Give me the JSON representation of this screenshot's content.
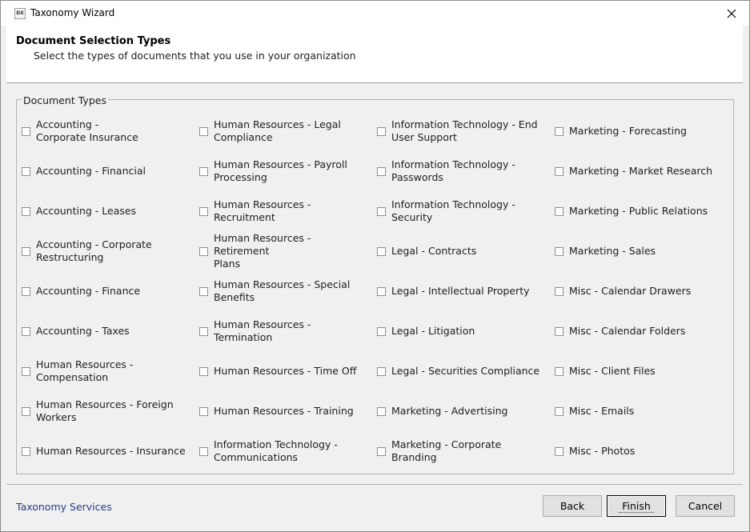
{
  "window": {
    "title": "Taxonomy Wizard",
    "icon_text": "DX"
  },
  "header": {
    "title": "Document Selection Types",
    "subtitle": "Select the types of documents that you use in your organization"
  },
  "group": {
    "label": "Document Types",
    "columns": [
      [
        "Accounting  - \nCorporate Insurance",
        "Accounting  - Financial",
        "Accounting  - Leases",
        "Accounting - Corporate\nRestructuring",
        "Accounting - Finance",
        "Accounting - Taxes",
        "Human Resources -\nCompensation",
        "Human Resources - Foreign\nWorkers",
        "Human Resources - Insurance"
      ],
      [
        "Human Resources - Legal\nCompliance",
        "Human Resources - Payroll\nProcessing",
        "Human Resources - Recruitment",
        "Human Resources - Retirement\nPlans",
        "Human Resources - Special\nBenefits",
        "Human Resources - Termination",
        "Human Resources - Time Off",
        "Human Resources - Training",
        "Information Technology -\nCommunications"
      ],
      [
        "Information Technology - End\nUser Support",
        "Information Technology -\nPasswords",
        "Information Technology -\nSecurity",
        "Legal - Contracts",
        "Legal - Intellectual Property",
        "Legal - Litigation",
        "Legal - Securities Compliance",
        "Marketing - Advertising",
        "Marketing - Corporate Branding"
      ],
      [
        "Marketing - Forecasting",
        "Marketing - Market Research",
        "Marketing - Public Relations",
        "Marketing - Sales",
        "Misc - Calendar Drawers",
        "Misc - Calendar Folders",
        "Misc - Client Files",
        "Misc - Emails",
        "Misc - Photos"
      ]
    ]
  },
  "footer": {
    "link": "Taxonomy Services",
    "back": "Back",
    "finish": "Finish",
    "cancel": "Cancel"
  },
  "colors": {
    "link": "#1f3d8c",
    "background": "#f0f0f0"
  },
  "icons": {
    "close": "close-icon",
    "app": "app-icon"
  }
}
